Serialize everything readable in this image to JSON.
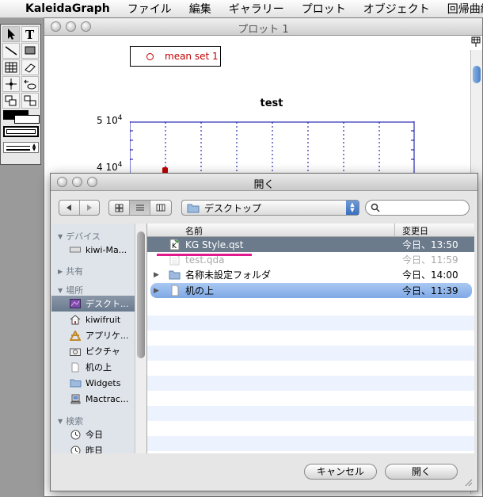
{
  "menubar": {
    "app": "KaleidaGraph",
    "items": [
      "ファイル",
      "編集",
      "ギャラリー",
      "プロット",
      "オブジェクト",
      "回帰曲線"
    ]
  },
  "plot_window": {
    "title": "プロット 1",
    "legend": "mean set 1",
    "plot_title": "test",
    "y_ticks": [
      {
        "mantissa": "5 10",
        "exp": "4"
      },
      {
        "mantissa": "4 10",
        "exp": "4"
      }
    ]
  },
  "dialog": {
    "title": "開く",
    "location": "デスクトップ",
    "search_placeholder": "",
    "sidebar": {
      "sections": [
        "デバイス",
        "共有",
        "場所",
        "検索"
      ],
      "device_items": [
        "kiwi-Ma..."
      ],
      "place_items": [
        "デスクト...",
        "kiwifruit",
        "アプリケ...",
        "ピクチャ",
        "机の上",
        "Widgets",
        "Mactrac..."
      ],
      "search_items": [
        "今日",
        "昨日"
      ]
    },
    "columns": {
      "name": "名前",
      "date": "変更日"
    },
    "files": [
      {
        "name": "KG Style.qst",
        "date": "今日、13:50"
      },
      {
        "name": "test.qda",
        "date": "今日、11:59"
      },
      {
        "name": "名称未設定フォルダ",
        "date": "今日、14:00"
      },
      {
        "name": "机の上",
        "date": "今日、11:39"
      }
    ],
    "buttons": {
      "cancel": "キャンセル",
      "open": "開く"
    }
  },
  "colors": {
    "legend_red": "#c00000",
    "selection_gray": "#6c7b8c",
    "selection_blue": "#8db3ea",
    "highlight_magenta": "#e0198c"
  }
}
